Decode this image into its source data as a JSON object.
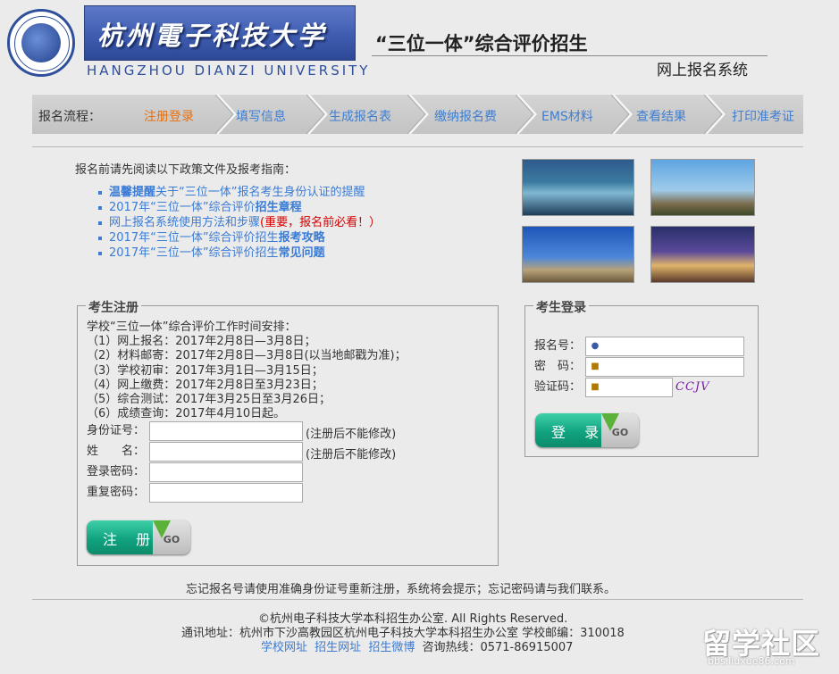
{
  "header": {
    "university_cn": "杭州電子科技大学",
    "university_en": "HANGZHOU DIANZI UNIVERSITY",
    "title": "“三位一体”综合评价招生",
    "subtitle": "网上报名系统"
  },
  "process": {
    "label": "报名流程：",
    "steps": [
      "注册登录",
      "填写信息",
      "生成报名表",
      "缴纳报名费",
      "EMS材料",
      "查看结果",
      "打印准考证"
    ]
  },
  "intro": "报名前请先阅读以下政策文件及报考指南：",
  "notices": [
    {
      "a": "温馨提醒",
      "b": "关于“三位一体”报名考生身份认证的提醒"
    },
    {
      "a": "2017年“三位一体”综合评价",
      "b": "招生章程"
    },
    {
      "a": "网上报名系统使用方法和步骤",
      "b": "(重要，报名前必看！）"
    },
    {
      "a": "2017年“三位一体”综合评价招生",
      "b": "报考攻略"
    },
    {
      "a": "2017年“三位一体”综合评价招生",
      "b": "常见问题"
    }
  ],
  "register": {
    "legend": "考生注册",
    "schedule": [
      "学校“三位一体”综合评价工作时间安排：",
      "（1）网上报名：2017年2月8日—3月8日；",
      "（2）材料邮寄：2017年2月8日—3月8日(以当地邮戳为准)；",
      "（3）学校初审：2017年3月1日—3月15日；",
      "（4）网上缴费：2017年2月8日至3月23日；",
      "（5）综合测试：2017年3月25日至3月26日；",
      "（6）成绩查询：2017年4月10日起。"
    ],
    "fields": [
      {
        "label": "身份证号：",
        "hint": "(注册后不能修改)"
      },
      {
        "label": "姓　　名：",
        "hint": "(注册后不能修改)"
      },
      {
        "label": "登录密码：",
        "hint": ""
      },
      {
        "label": "重复密码：",
        "hint": ""
      }
    ],
    "button": "注 册",
    "go": "GO"
  },
  "login": {
    "legend": "考生登录",
    "fields": [
      "报名号：",
      "密　码：",
      "验证码："
    ],
    "captcha": "CCJV",
    "button": "登 录",
    "go": "GO"
  },
  "footer": {
    "forget": "忘记报名号请使用准确身份证号重新注册，系统将会提示；忘记密码请与我们联系。",
    "copyright": "©杭州电子科技大学本科招生办公室. All Rights Reserved.",
    "address": "通讯地址：杭州市下沙高教园区杭州电子科技大学本科招生办公室 学校邮编：310018",
    "links": [
      "学校网址",
      "招生网址",
      "招生微博"
    ],
    "hotline": "咨询热线：0571-86915007"
  },
  "watermark": {
    "big": "留学社区",
    "small": "bbs.liuxue86.com"
  }
}
